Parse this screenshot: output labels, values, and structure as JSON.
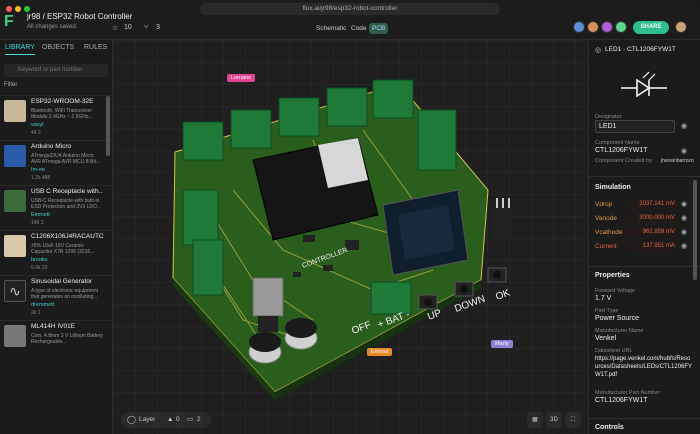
{
  "browser": {
    "url": "flux.ai/jr98/esp32-robot-controller"
  },
  "project": {
    "title": "jr98 / ESP32 Robot Controller",
    "subtitle": "All changes saved."
  },
  "toolbar": {
    "stars": "10",
    "forks": "3",
    "tabs": [
      "Schematic",
      "Code",
      "PCB"
    ],
    "share_label": "SHARE"
  },
  "left_panel": {
    "tabs": [
      "LIBRARY",
      "OBJECTS",
      "RULES"
    ],
    "search_placeholder": "Keyword or part number",
    "filter_label": "Filter",
    "items": [
      {
        "title": "ESP32-WROOM-32E",
        "desc": "Bluetooth, WiFi Transceiver Module 2.4GHz ~ 2.5GHz...",
        "author": "vasyl",
        "stats": "44   2"
      },
      {
        "title": "Arduino Micro",
        "desc": "ATmega32U4 Arduino Micro AVR ATmega AVR MCU 8-Bit...",
        "author": "Im-ee",
        "stats": "1.2k   488"
      },
      {
        "title": "USB C Receptacle with...",
        "desc": "USB-C Receptacle with built-in ESD Protection and 3V3 LDO...",
        "author": "Emmett",
        "stats": "149   3"
      },
      {
        "title": "C1206X106J4RACAUTO",
        "desc": "±5% 10uF 16V Ceramic Capacitor X7R 1206 (3216...",
        "author": "brooks",
        "stats": "5.5k   22"
      },
      {
        "title": "Sinusoidal Generator",
        "desc": "A type of electronic equipment that generates an oscillating...",
        "author": "dremmett",
        "stats": "2k   1"
      },
      {
        "title": "ML414H IV01E",
        "desc": "Coin, 4.8mm 3 V Lithium Battery Rechargeable...",
        "author": "",
        "stats": ""
      }
    ]
  },
  "canvas": {
    "board_text": [
      "OFF",
      "+ BAT -",
      "UP",
      "DOWN",
      "OK",
      "CONTROLLER"
    ],
    "cursors": [
      {
        "name": "Lorraine",
        "color": "#e0438f"
      },
      {
        "name": "Emmet",
        "color": "#e6892a"
      },
      {
        "name": "Marty",
        "color": "#8f7fd6"
      }
    ],
    "bottom": {
      "layer_label": "Layer",
      "warnings": "0",
      "comments": "2"
    },
    "view_buttons": [
      "▦",
      "3D",
      "⛶"
    ]
  },
  "right_panel": {
    "header": "LED1 · CTL1206FYW1T",
    "designator_label": "Designator",
    "designator_value": "LED1",
    "component_name_label": "Component Name",
    "component_name": "CTL1206FYW1T",
    "created_by": "Component Created by",
    "created_by_user": "jharwinbarrozo",
    "simulation_title": "Simulation",
    "simulation": [
      {
        "name": "Vdrop",
        "value": "2037.141 mV"
      },
      {
        "name": "Vanode",
        "value": "3000.000 mV"
      },
      {
        "name": "Vcathode",
        "value": "962.859 mV"
      },
      {
        "name": "Current",
        "value": "137.951 mA"
      }
    ],
    "properties_title": "Properties",
    "properties": [
      {
        "label": "Forward Voltage",
        "value": "1.7 V"
      },
      {
        "label": "Part Type",
        "value": "Power Source"
      },
      {
        "label": "Manufacturer Name",
        "value": "Venkel"
      },
      {
        "label": "Datasheet URL",
        "value": "https://page.venkel.com/hubfs/Resources/Datasheets/LEDs/CTL1206FYW1T.pdf"
      },
      {
        "label": "Manufacturer Part Number",
        "value": "CTL1206FYW1T"
      }
    ],
    "controls_title": "Controls"
  },
  "colors": {
    "accent": "#2cbe8b",
    "board": "#2f6a1f",
    "sim_value": "#e5663f"
  }
}
